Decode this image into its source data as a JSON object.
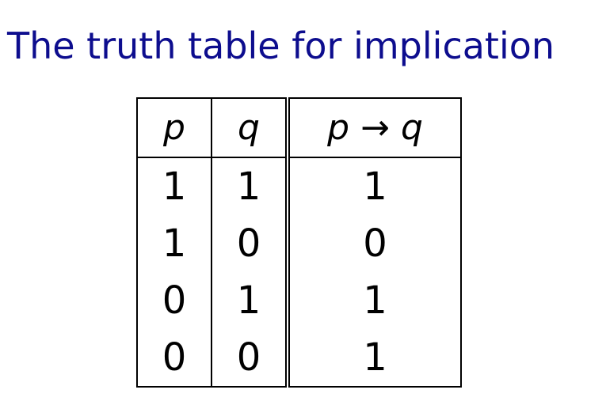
{
  "slide": {
    "title": "The truth table for implication"
  },
  "table": {
    "header": {
      "p": "p",
      "q": "q",
      "impl_left": "p",
      "impl_arrow": "→",
      "impl_right": "q"
    },
    "rows": [
      [
        "1",
        "1",
        "1"
      ],
      [
        "1",
        "0",
        "0"
      ],
      [
        "0",
        "1",
        "1"
      ],
      [
        "0",
        "0",
        "1"
      ]
    ]
  }
}
